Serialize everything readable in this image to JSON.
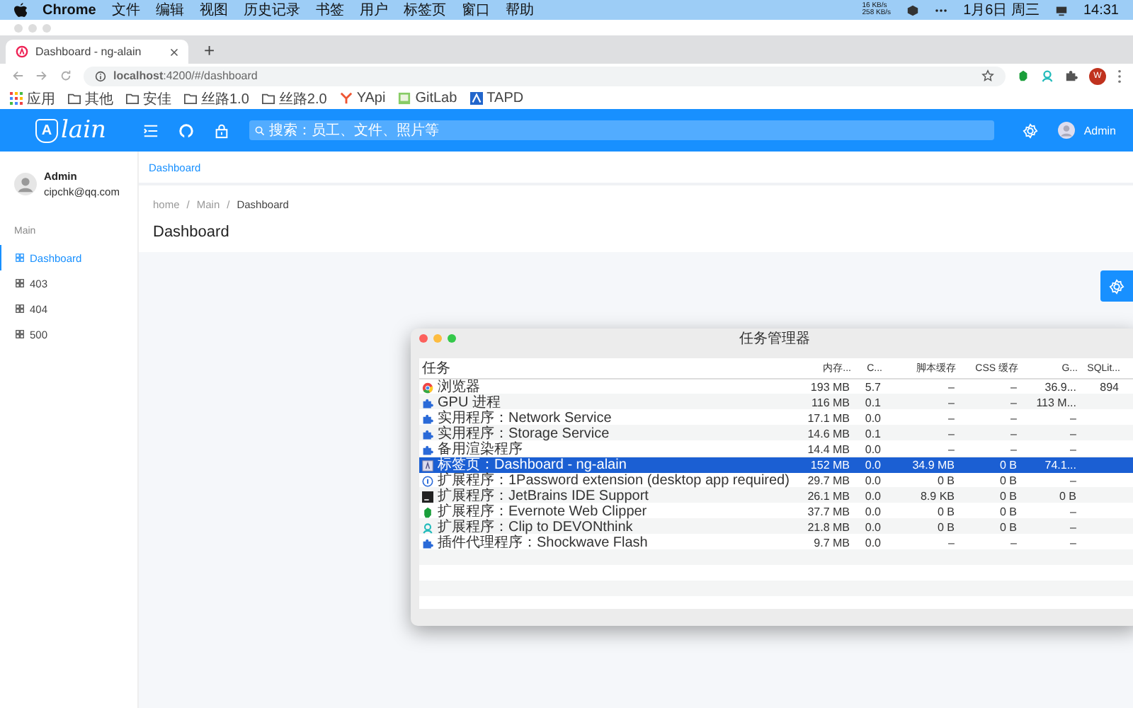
{
  "menubar": {
    "app": "Chrome",
    "menus": [
      "文件",
      "编辑",
      "视图",
      "历史记录",
      "书签",
      "用户",
      "标签页",
      "窗口",
      "帮助"
    ],
    "net_speed": [
      "16 KB/s",
      "258 KB/s"
    ],
    "date": "1月6日 周三",
    "time": "14:31"
  },
  "browser": {
    "tabs": [
      {
        "title": "Dashboard - ng-alain",
        "selected": true
      }
    ],
    "new_tab": "+",
    "url": "**localhost**:4200/#/dashboard",
    "profile_initial": "W",
    "bookmarks": [
      {
        "label": "应用",
        "kind": "apps"
      },
      {
        "label": "其他",
        "kind": "folder"
      },
      {
        "label": "安佳",
        "kind": "folder"
      },
      {
        "label": "丝路1.0",
        "kind": "folder"
      },
      {
        "label": "丝路2.0",
        "kind": "folder"
      },
      {
        "label": "YApi",
        "kind": "yapi"
      },
      {
        "label": "GitLab",
        "kind": "gitlab"
      },
      {
        "label": "TAPD",
        "kind": "tapd"
      }
    ]
  },
  "header": {
    "logo_mark": "A",
    "logo_text": "lain",
    "search": {
      "placeholder": "搜索：员工、文件、照片等"
    },
    "user": "Admin"
  },
  "sidebar": {
    "user": {
      "name": "Admin",
      "email": "cipchk@qq.com"
    },
    "group": "Main",
    "items": [
      {
        "label": "Dashboard",
        "selected": true
      },
      {
        "label": "403",
        "selected": false
      },
      {
        "label": "404",
        "selected": false
      },
      {
        "label": "500",
        "selected": false
      }
    ]
  },
  "content": {
    "tabs": [
      {
        "label": "Dashboard",
        "selected": true
      }
    ],
    "breadcrumb": [
      "home",
      "Main",
      "Dashboard"
    ],
    "breadcrumb_separators": [
      "/",
      "/"
    ],
    "title": "Dashboard"
  },
  "task_manager": {
    "title": "任务管理器",
    "columns": [
      "任务",
      "内存...",
      "C...",
      "脚本缓存",
      "CSS 缓存",
      "G...",
      "SQLit..."
    ],
    "rows": [
      {
        "kind": "browser",
        "task": "浏览器",
        "values": [
          "193 MB",
          "5.7",
          "–",
          "–",
          "36.9...",
          "894"
        ],
        "selected": false
      },
      {
        "kind": "extension",
        "task": "GPU 进程",
        "values": [
          "116 MB",
          "0.1",
          "–",
          "–",
          "113 M..."
        ],
        "selected": false
      },
      {
        "kind": "extension",
        "task": "实用程序：Network Service",
        "values": [
          "17.1 MB",
          "0.0",
          "–",
          "–",
          "–"
        ],
        "selected": false
      },
      {
        "kind": "extension",
        "task": "实用程序：Storage Service",
        "values": [
          "14.6 MB",
          "0.1",
          "–",
          "–",
          "–"
        ],
        "selected": false
      },
      {
        "kind": "extension",
        "task": "备用渲染程序",
        "values": [
          "14.4 MB",
          "0.0",
          "–",
          "–",
          "–"
        ],
        "selected": false
      },
      {
        "kind": "page",
        "task": "标签页：Dashboard - ng-alain",
        "values": [
          "152 MB",
          "0.0",
          "34.9 MB",
          "0 B",
          "74.1..."
        ],
        "selected": true
      },
      {
        "kind": "info",
        "task": "扩展程序：1Password extension (desktop app required)",
        "values": [
          "29.7 MB",
          "0.0",
          "0 B",
          "0 B",
          "–"
        ],
        "selected": false
      },
      {
        "kind": "jetbrains",
        "task": "扩展程序：JetBrains IDE Support",
        "values": [
          "26.1 MB",
          "0.0",
          "8.9 KB",
          "0 B",
          "0 B"
        ],
        "selected": false
      },
      {
        "kind": "evernote",
        "task": "扩展程序：Evernote Web Clipper",
        "values": [
          "37.7 MB",
          "0.0",
          "0 B",
          "0 B",
          "–"
        ],
        "selected": false
      },
      {
        "kind": "devonthink",
        "task": "扩展程序：Clip to DEVONthink",
        "values": [
          "21.8 MB",
          "0.0",
          "0 B",
          "0 B",
          "–"
        ],
        "selected": false
      },
      {
        "kind": "extension",
        "task": "插件代理程序：Shockwave Flash",
        "values": [
          "9.7 MB",
          "0.0",
          "–",
          "–",
          "–"
        ],
        "selected": false
      }
    ]
  }
}
